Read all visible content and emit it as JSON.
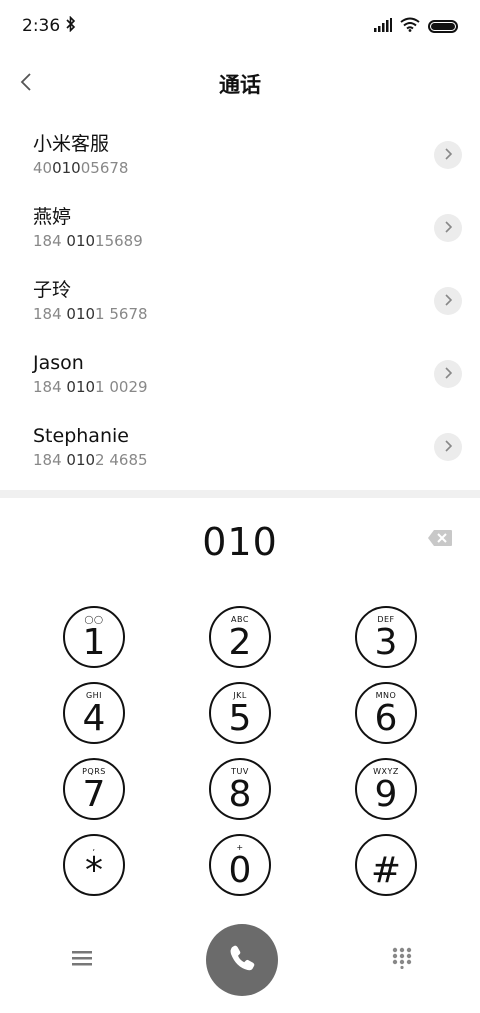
{
  "status_bar": {
    "time": "2:36"
  },
  "header": {
    "title": "通话"
  },
  "contacts": [
    {
      "name": "小米客服",
      "number_pre": "40",
      "number_match": "010",
      "number_post": "05678"
    },
    {
      "name": "燕婷",
      "number_pre": "184 ",
      "number_match": "010",
      "number_post": "15689"
    },
    {
      "name": "子玲",
      "number_pre": "184 ",
      "number_match": "010",
      "number_post": "1 5678"
    },
    {
      "name": "Jason",
      "number_pre": "184 ",
      "number_match": "010",
      "number_post": "1 0029"
    },
    {
      "name": "Stephanie",
      "number_pre": "184 ",
      "number_match": "010",
      "number_post": "2 4685"
    }
  ],
  "dialer": {
    "digits": "010"
  },
  "keypad": {
    "keys": [
      {
        "main": "1",
        "sub": "◯◯"
      },
      {
        "main": "2",
        "sub": "ABC"
      },
      {
        "main": "3",
        "sub": "DEF"
      },
      {
        "main": "4",
        "sub": "GHI"
      },
      {
        "main": "5",
        "sub": "JKL"
      },
      {
        "main": "6",
        "sub": "MNO"
      },
      {
        "main": "7",
        "sub": "PQRS"
      },
      {
        "main": "8",
        "sub": "TUV"
      },
      {
        "main": "9",
        "sub": "WXYZ"
      },
      {
        "main": "*",
        "sub": ","
      },
      {
        "main": "0",
        "sub": "+"
      },
      {
        "main": "#",
        "sub": ""
      }
    ]
  },
  "colors": {
    "call_button": "#6b6b6b",
    "divider": "#f0f0f0",
    "chevron_bg": "#ececec"
  },
  "icons": {
    "back": "chevron-left-icon",
    "bluetooth": "bluetooth-icon",
    "signal": "signal-icon",
    "wifi": "wifi-icon",
    "battery": "battery-icon",
    "row_action": "chevron-right-icon",
    "delete": "backspace-icon",
    "menu": "menu-icon",
    "call": "phone-icon",
    "keypad_toggle": "dialpad-icon"
  }
}
